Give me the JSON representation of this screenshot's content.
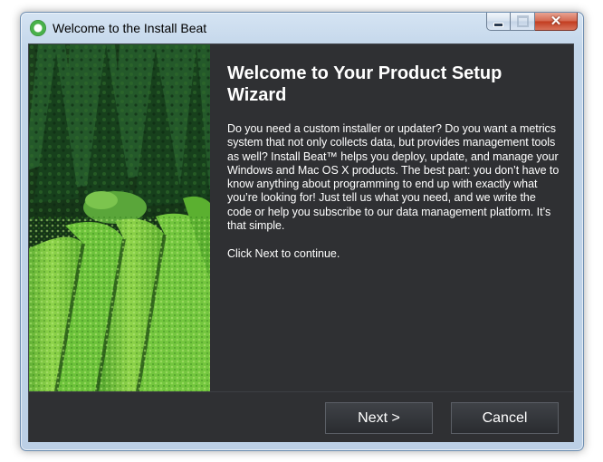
{
  "window": {
    "title": "Welcome to the Install Beat",
    "icon": "install-beat-logo-icon"
  },
  "title_controls": {
    "minimize_icon": "minimize-icon",
    "maximize_icon": "maximize-icon",
    "close_icon": "close-icon",
    "close_glyph": "✕"
  },
  "side_image": {
    "description_icon": "tea-plantation-image"
  },
  "content": {
    "heading": "Welcome to Your Product Setup Wizard",
    "description": "Do you need a custom installer or updater? Do you want a metrics system that not only collects data, but provides management tools as well? Install Beat™ helps you deploy, update, and manage your Windows and Mac OS X products. The best part: you don’t have to know anything about programming to end up with exactly what you’re looking for! Just tell us what you need, and we write the code or help you subscribe to our data management platform. It’s that simple.",
    "note": "Click Next to continue."
  },
  "buttons": {
    "next": "Next >",
    "cancel": "Cancel"
  },
  "colors": {
    "panel_background": "#2f3033",
    "text": "#ffffff",
    "window_frame": "#c3d6ea",
    "close_button": "#c23b1f"
  }
}
